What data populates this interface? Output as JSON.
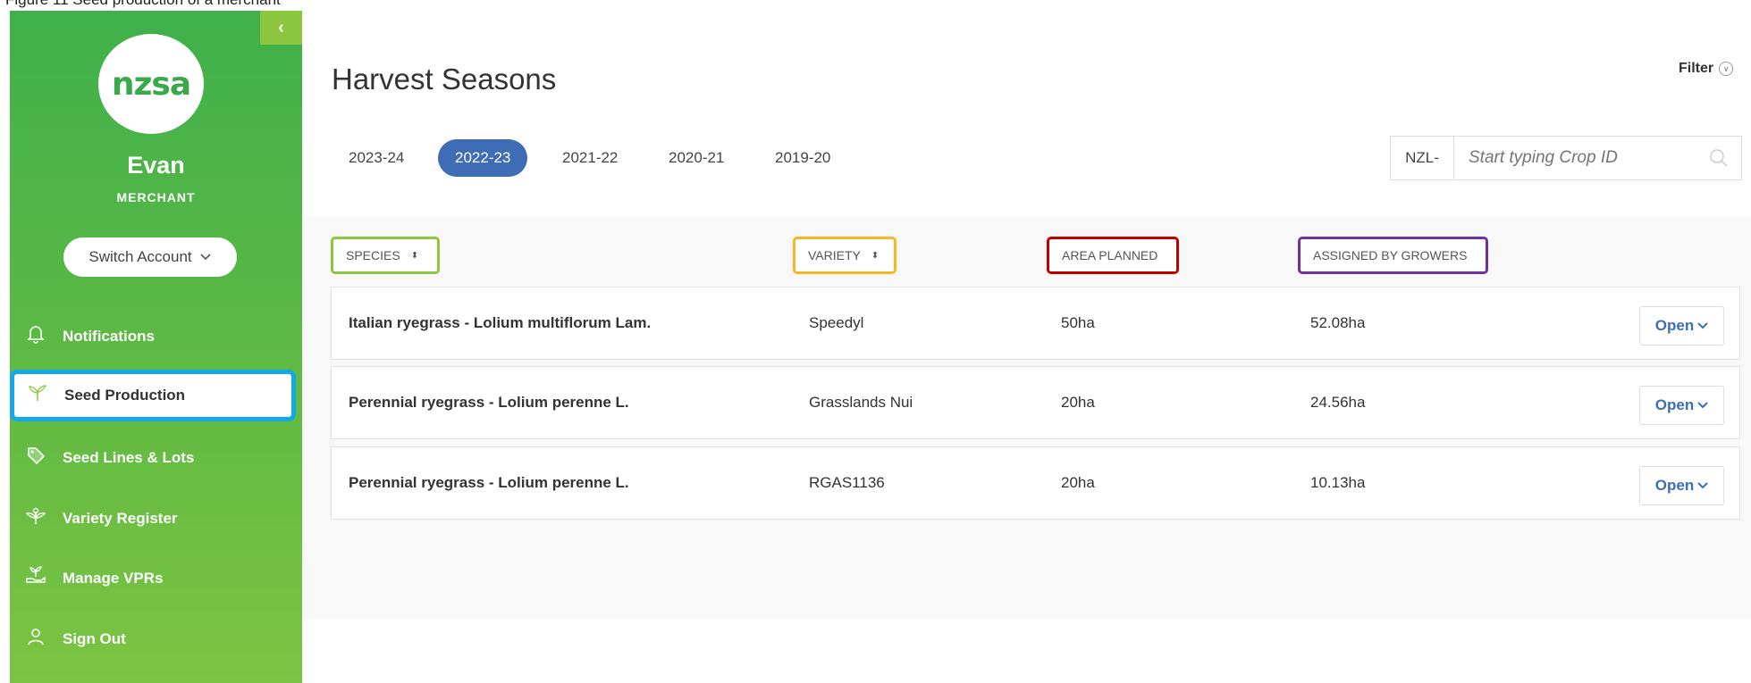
{
  "caption": "Figure 11  Seed production of a merchant",
  "sidebar": {
    "collapse_icon": "‹",
    "logo_text": "nzsa",
    "user_name": "Evan",
    "user_role": "MERCHANT",
    "switch_account": "Switch Account",
    "items": [
      {
        "label": "Notifications",
        "icon": "bell-icon"
      },
      {
        "label": "Seed Production",
        "icon": "sprout-icon",
        "selected": true
      },
      {
        "label": "Seed Lines & Lots",
        "icon": "tag-icon"
      },
      {
        "label": "Variety Register",
        "icon": "plant-icon"
      },
      {
        "label": "Manage VPRs",
        "icon": "hand-plant-icon"
      },
      {
        "label": "Sign Out",
        "icon": "user-icon"
      }
    ],
    "selected_outline_color": "#13a9e6"
  },
  "main": {
    "title": "Harvest Seasons",
    "filter_label": "Filter",
    "tabs": [
      "2023-24",
      "2022-23",
      "2021-22",
      "2020-21",
      "2019-20"
    ],
    "active_tab": "2022-23",
    "crop_prefix": "NZL-",
    "crop_placeholder": "Start typing Crop ID",
    "columns": [
      {
        "label": "SPECIES",
        "sortable": true,
        "outline_color": "#8cc63f"
      },
      {
        "label": "VARIETY",
        "sortable": true,
        "outline_color": "#f5b820"
      },
      {
        "label": "AREA PLANNED",
        "sortable": false,
        "outline_color": "#c00000"
      },
      {
        "label": "ASSIGNED BY GROWERS",
        "sortable": false,
        "outline_color": "#7030a0"
      }
    ],
    "rows": [
      {
        "species": "Italian ryegrass - Lolium multiflorum Lam.",
        "variety": "Speedyl",
        "area_planned": "50ha",
        "assigned": "52.08ha",
        "action": "Open"
      },
      {
        "species": "Perennial ryegrass - Lolium perenne L.",
        "variety": "Grasslands Nui",
        "area_planned": "20ha",
        "assigned": "24.56ha",
        "action": "Open"
      },
      {
        "species": "Perennial ryegrass - Lolium perenne L.",
        "variety": "RGAS1136",
        "area_planned": "20ha",
        "assigned": "10.13ha",
        "action": "Open"
      }
    ],
    "accent_color": "#3e6db5"
  }
}
